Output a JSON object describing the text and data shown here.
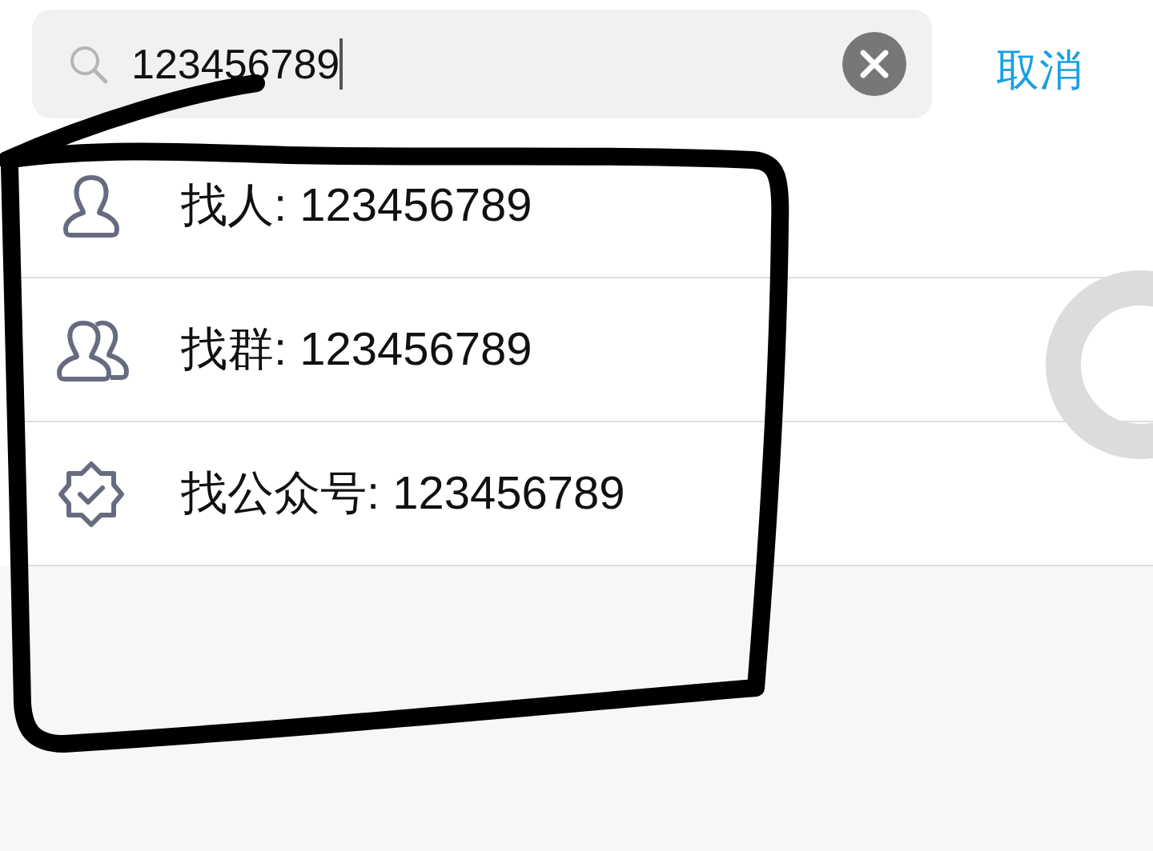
{
  "search": {
    "value": "123456789",
    "cancel": "取消"
  },
  "results": [
    {
      "kind": "person",
      "label": "找人: 123456789"
    },
    {
      "kind": "group",
      "label": "找群: 123456789"
    },
    {
      "kind": "official",
      "label": "找公众号: 123456789"
    }
  ]
}
